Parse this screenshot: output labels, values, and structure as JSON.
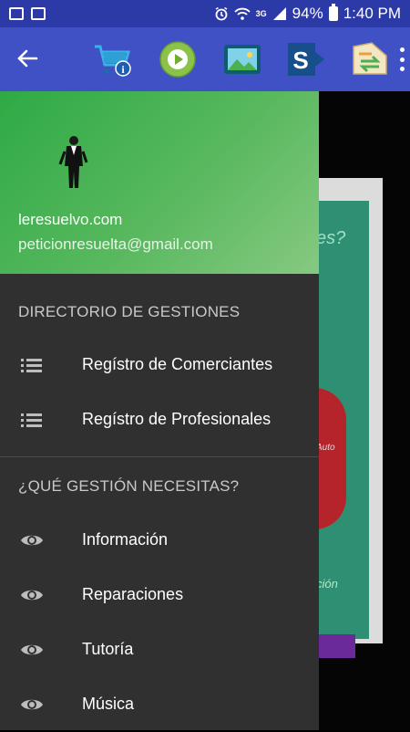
{
  "status_bar": {
    "battery_percent": "94%",
    "network": "3G",
    "time": "1:40 PM"
  },
  "toolbar": {
    "icons": [
      "back-arrow-icon",
      "shopping-cart-info-icon",
      "play-circle-icon",
      "image-gallery-icon",
      "sharepoint-icon",
      "contacts-sync-icon",
      "overflow-menu-icon"
    ],
    "color": "#3f51c5"
  },
  "drawer": {
    "header": {
      "site_name": "leresuelvo.com",
      "email": "peticionresuelta@gmail.com",
      "gradient_start": "#2faa45",
      "gradient_end": "#86c981"
    },
    "section1_title": "DIRECTORIO DE GESTIONES",
    "section1_items": [
      {
        "label": "Regístro de Comerciantes",
        "icon": "list-icon"
      },
      {
        "label": "Regístro de Profesionales",
        "icon": "list-icon"
      }
    ],
    "section2_title": "¿QUÉ GESTIÓN NECESITAS?",
    "section2_items": [
      {
        "label": "Información",
        "icon": "eye-icon"
      },
      {
        "label": "Reparaciones",
        "icon": "eye-icon"
      },
      {
        "label": "Tutoría",
        "icon": "eye-icon"
      },
      {
        "label": "Música",
        "icon": "eye-icon"
      }
    ]
  },
  "background": {
    "poster_text_1": "es?",
    "poster_text_2": "Auto",
    "poster_text_3": "ción"
  }
}
